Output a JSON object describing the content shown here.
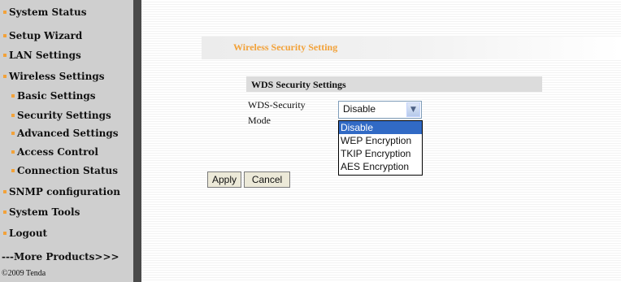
{
  "sidebar": {
    "items": [
      {
        "label": "System Status",
        "sub": false
      },
      {
        "label": "Setup Wizard",
        "sub": false
      },
      {
        "label": "LAN Settings",
        "sub": false
      },
      {
        "label": "Wireless Settings",
        "sub": false
      },
      {
        "label": "Basic Settings",
        "sub": true
      },
      {
        "label": "Security Settings",
        "sub": true
      },
      {
        "label": "Advanced Settings",
        "sub": true
      },
      {
        "label": "Access Control",
        "sub": true
      },
      {
        "label": "Connection Status",
        "sub": true
      },
      {
        "label": "SNMP configuration",
        "sub": false
      },
      {
        "label": "System Tools",
        "sub": false
      },
      {
        "label": "Logout",
        "sub": false
      }
    ],
    "more_products": "---More Products>>>",
    "copyright": "©2009 Tenda"
  },
  "main": {
    "section_title": "Wireless Security Setting",
    "wds_title": "WDS Security Settings",
    "mode_label": "WDS-Security Mode",
    "mode_select": {
      "value": "Disable",
      "options": [
        "Disable",
        "WEP Encryption",
        "TKIP Encryption",
        "AES Encryption"
      ],
      "selected_index": 0
    },
    "apply_label": "Apply",
    "cancel_label": "Cancel"
  },
  "colors": {
    "accent_orange": "#f2a23a",
    "sidebar_bg": "#cfcfcf",
    "selection_blue": "#316ac5"
  }
}
